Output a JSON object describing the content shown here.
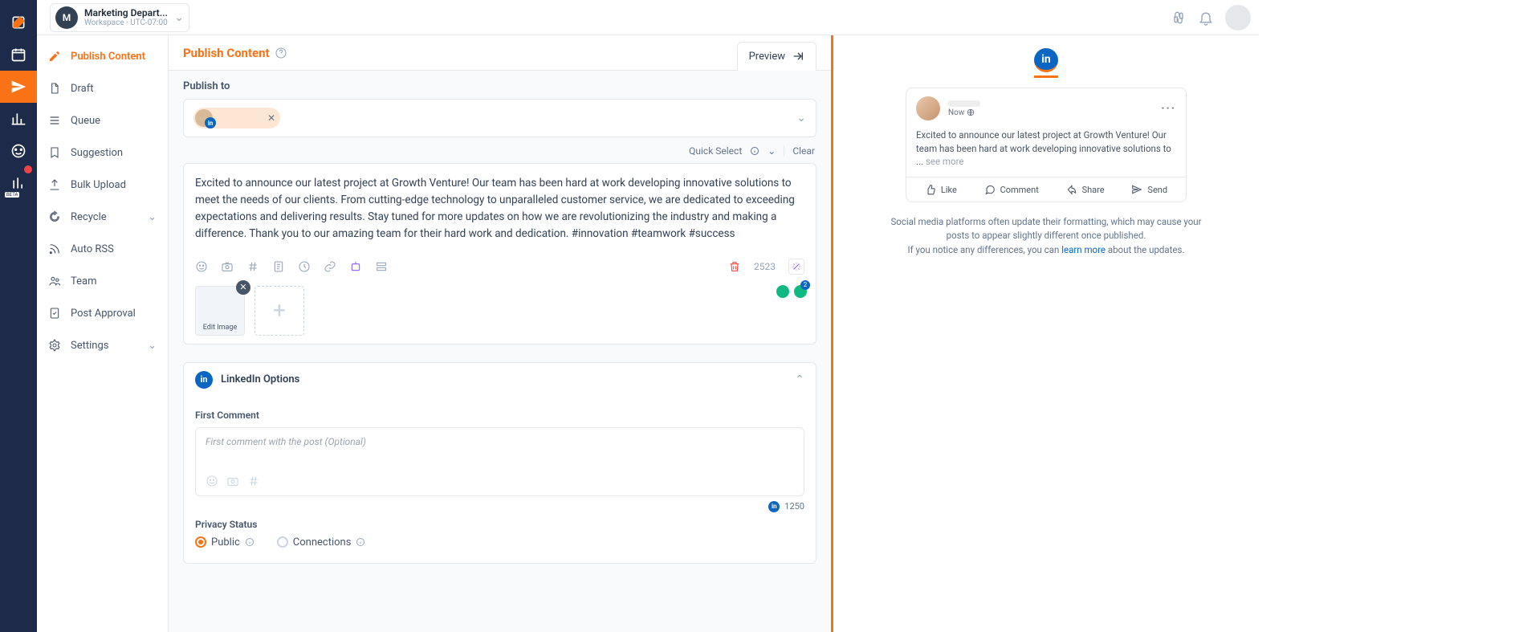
{
  "workspace": {
    "initial": "M",
    "name": "Marketing Depart...",
    "sub": "Workspace · UTC-07:00"
  },
  "rail": [
    {
      "name": "compose-icon"
    },
    {
      "name": "calendar-icon"
    },
    {
      "name": "publish-icon",
      "active": true
    },
    {
      "name": "analytics-icon"
    },
    {
      "name": "inbox-icon"
    },
    {
      "name": "reports-icon",
      "beta": "BETA",
      "badge": true
    }
  ],
  "sidebar": {
    "items": [
      {
        "label": "Publish Content",
        "icon": "pencil-icon",
        "active": true
      },
      {
        "label": "Draft",
        "icon": "document-icon"
      },
      {
        "label": "Queue",
        "icon": "list-icon"
      },
      {
        "label": "Suggestion",
        "icon": "bookmark-icon"
      },
      {
        "label": "Bulk Upload",
        "icon": "upload-icon"
      },
      {
        "label": "Recycle",
        "icon": "recycle-icon",
        "expandable": true
      },
      {
        "label": "Auto RSS",
        "icon": "rss-icon"
      },
      {
        "label": "Team",
        "icon": "team-icon"
      },
      {
        "label": "Post Approval",
        "icon": "approval-icon"
      },
      {
        "label": "Settings",
        "icon": "gear-icon",
        "expandable": true
      }
    ]
  },
  "compose": {
    "title": "Publish Content",
    "preview_btn": "Preview",
    "publish_to_label": "Publish to",
    "quick_select": "Quick Select",
    "clear": "Clear",
    "content": "Excited to announce our latest project at Growth Venture! Our team has been hard at work developing innovative solutions to meet the needs of our clients. From cutting-edge technology to unparalleled customer service, we are dedicated to exceeding expectations and delivering results. Stay tuned for more updates on how we are revolutionizing the industry and making a difference. Thank you to our amazing team for their hard work and dedication. #innovation #teamwork #success",
    "char_count": "2523",
    "edit_image": "Edit Image"
  },
  "linkedin_options": {
    "title": "LinkedIn Options",
    "first_comment_label": "First Comment",
    "first_comment_placeholder": "First comment with the post (Optional)",
    "fc_remaining": "1250",
    "privacy_label": "Privacy Status",
    "public": "Public",
    "connections": "Connections"
  },
  "preview": {
    "now": "Now",
    "snippet": "Excited to announce our latest project at Growth Venture! Our team has been hard at work developing innovative solutions to",
    "see_more": "see more",
    "like": "Like",
    "comment": "Comment",
    "share": "Share",
    "send": "Send",
    "note_1": "Social media platforms often update their formatting, which may cause your posts to appear slightly different once published.",
    "note_2a": "If you notice any differences, you can ",
    "note_2b": "learn more",
    "note_2c": " about the updates."
  }
}
